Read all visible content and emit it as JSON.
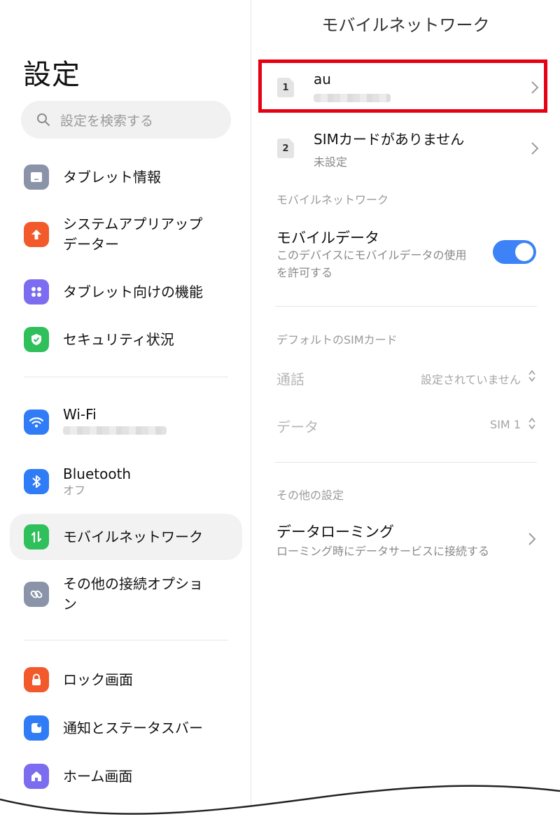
{
  "left": {
    "title": "設定",
    "search_placeholder": "設定を検索する",
    "items": [
      {
        "label": "タブレット情報",
        "icon": "tablet-icon",
        "color": "#8a93a8"
      },
      {
        "label": "システムアプリアップ\nデーター",
        "icon": "arrow-up-icon",
        "color": "#f25a2b"
      },
      {
        "label": "タブレット向けの機能",
        "icon": "grid-dots-icon",
        "color": "#7b6cf0"
      },
      {
        "label": "セキュリティ状況",
        "icon": "shield-check-icon",
        "color": "#2fbf5b"
      },
      {
        "label": "Wi-Fi",
        "icon": "wifi-icon",
        "color": "#2f7cf6"
      },
      {
        "label": "Bluetooth",
        "sub": "オフ",
        "icon": "bluetooth-icon",
        "color": "#2f7cf6"
      },
      {
        "label": "モバイルネットワーク",
        "icon": "mobile-data-icon",
        "color": "#2fbf5b"
      },
      {
        "label": "その他の接続オプショ\nン",
        "icon": "link-icon",
        "color": "#8a93a8"
      },
      {
        "label": "ロック画面",
        "icon": "lock-icon",
        "color": "#f25a2b"
      },
      {
        "label": "通知とステータスバー",
        "icon": "notification-icon",
        "color": "#2f7cf6"
      },
      {
        "label": "ホーム画面",
        "icon": "home-icon",
        "color": "#7b6cf0"
      }
    ]
  },
  "right": {
    "title": "モバイルネットワーク",
    "sims": [
      {
        "slot": "1",
        "name": "au"
      },
      {
        "slot": "2",
        "name": "SIMカードがありません",
        "sub": "未設定"
      }
    ],
    "section_mobile": "モバイルネットワーク",
    "mobile_data": {
      "title": "モバイルデータ",
      "desc": "このデバイスにモバイルデータの使用\nを許可する",
      "enabled": true
    },
    "section_default_sim": "デフォルトのSIMカード",
    "call": {
      "label": "通話",
      "value": "設定されていません"
    },
    "data": {
      "label": "データ",
      "value": "SIM 1"
    },
    "section_other": "その他の設定",
    "roaming": {
      "title": "データローミング",
      "desc": "ローミング時にデータサービスに接続する"
    }
  },
  "colors": {
    "accent": "#3d82f6",
    "highlight": "#e60012"
  }
}
